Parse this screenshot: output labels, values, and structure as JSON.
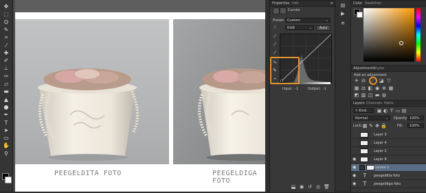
{
  "toolbar": {
    "tools": [
      {
        "icon": "move-icon",
        "glyph": "✥"
      },
      {
        "icon": "marquee-icon",
        "glyph": "⬚"
      },
      {
        "icon": "lasso-icon",
        "glyph": "ʘ"
      },
      {
        "icon": "quick-select-icon",
        "glyph": "✎"
      },
      {
        "icon": "crop-icon",
        "glyph": "⌗"
      },
      {
        "icon": "eyedropper-icon",
        "glyph": "⁄"
      },
      {
        "icon": "healing-icon",
        "glyph": "✚"
      },
      {
        "icon": "brush-icon",
        "glyph": "✐"
      },
      {
        "icon": "stamp-icon",
        "glyph": "⊥"
      },
      {
        "icon": "history-brush-icon",
        "glyph": "✑"
      },
      {
        "icon": "eraser-icon",
        "glyph": "▱"
      },
      {
        "icon": "gradient-icon",
        "glyph": "▬"
      },
      {
        "icon": "blur-icon",
        "glyph": "▲"
      },
      {
        "icon": "dodge-icon",
        "glyph": "●"
      },
      {
        "icon": "pen-icon",
        "glyph": "✒"
      },
      {
        "icon": "type-icon",
        "glyph": "T"
      },
      {
        "icon": "path-select-icon",
        "glyph": "➤"
      },
      {
        "icon": "shape-icon",
        "glyph": "▭"
      },
      {
        "icon": "hand-icon",
        "glyph": "✋"
      },
      {
        "icon": "zoom-icon",
        "glyph": "⚲"
      }
    ],
    "foreground_color": "#000000",
    "background_color": "#ffffff"
  },
  "document": {
    "caption_left": "PEEGELDITA FOTO",
    "caption_right": "PEEGELDIGA FOTO"
  },
  "properties": {
    "tabs": [
      "Properties",
      "Info"
    ],
    "header_label": "Curves",
    "preset_label": "Preset:",
    "preset_value": "Custom",
    "channel_value": "RGB",
    "auto_label": "Auto",
    "input_label": "Input:",
    "input_value": "-1",
    "output_label": "Output:",
    "output_value": "-1"
  },
  "color_panel": {
    "tabs": [
      "Color",
      "Swatches"
    ]
  },
  "adjustments": {
    "tabs": [
      "Adjustments",
      "Styles"
    ],
    "add_label": "Add an adjustment"
  },
  "layers": {
    "tabs": [
      "Layers",
      "Channels",
      "Paths"
    ],
    "kind_label": "Kind",
    "blend_mode": "Normal",
    "opacity_label": "Opacity:",
    "opacity_value": "100%",
    "lock_label": "Lock:",
    "fill_label": "Fill:",
    "fill_value": "100%",
    "rows": [
      {
        "name": "Layer 3",
        "visible": false,
        "type": "pixel"
      },
      {
        "name": "Layer 4",
        "visible": false,
        "type": "pixel"
      },
      {
        "name": "Layer 2",
        "visible": false,
        "type": "pixel"
      },
      {
        "name": "Layer 6",
        "visible": true,
        "type": "pixel"
      },
      {
        "name": "Curves 1",
        "visible": true,
        "type": "adjustment"
      },
      {
        "name": "peegeldita foto",
        "visible": true,
        "type": "text"
      },
      {
        "name": "peegeldiga foto",
        "visible": true,
        "type": "text"
      }
    ]
  },
  "colors": {
    "highlight": "#e8932f",
    "selection": "#5b6e86"
  }
}
